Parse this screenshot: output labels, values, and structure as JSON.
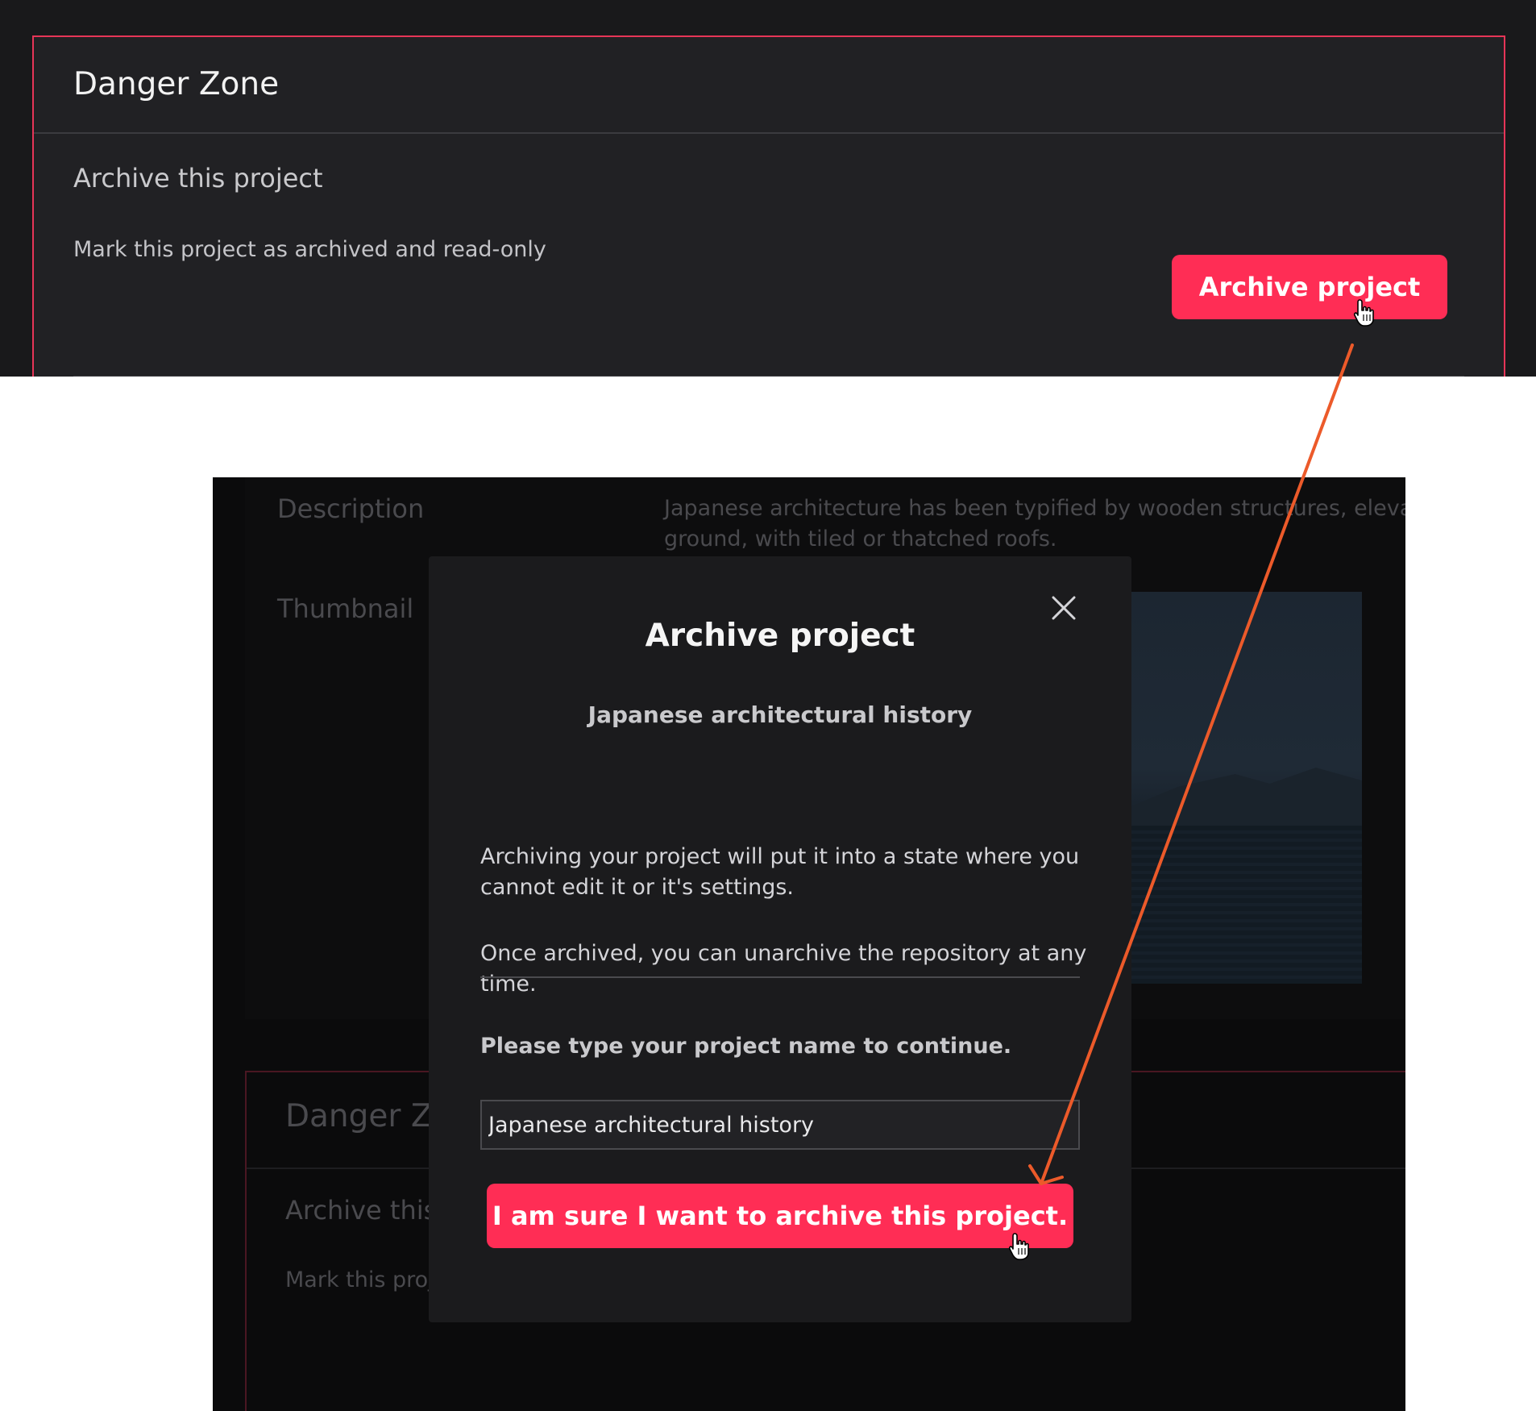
{
  "top_panel": {
    "danger_zone_title": "Danger Zone",
    "archive_heading": "Archive this project",
    "archive_description": "Mark this project as archived and read-only",
    "archive_button_label": "Archive project"
  },
  "background_form": {
    "description_label": "Description",
    "description_line1": "Japanese architecture has been typified by wooden structures, elevated s",
    "description_line2": "ground, with tiled or thatched roofs.",
    "thumbnail_label": "Thumbnail",
    "danger_zone_title_partial": "Danger Zo",
    "archive_heading_partial": "Archive this",
    "archive_description_partial": "Mark this proj"
  },
  "modal": {
    "title": "Archive project",
    "project_name": "Japanese architectural history",
    "paragraph_1": "Archiving your project will put it into a state where you cannot edit it or it's settings.",
    "paragraph_2": "Once archived, you can unarchive the repository at any time.",
    "confirm_prompt": "Please type your project name to continue.",
    "input_value": "Japanese architectural history",
    "confirm_button_label": "I am sure I want to archive this project.",
    "close_icon": "close-icon"
  },
  "colors": {
    "accent_red": "#ff2d55",
    "danger_border": "#e63557",
    "annotation_arrow": "#ec5a2a",
    "dark_bg": "#19191b",
    "modal_bg": "#1b1b1d"
  },
  "icons": {
    "cursor": "pointer-hand-cursor-icon",
    "close": "close-icon",
    "arrow": "annotation-arrow-icon"
  }
}
